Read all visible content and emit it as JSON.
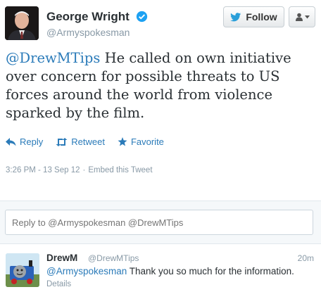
{
  "main_tweet": {
    "author_name": "George Wright",
    "author_handle": "@Armyspokesman",
    "mention": "@DrewMTips",
    "text": " He called on own initiative over concern for possible threats to US forces around the world from violence sparked by the film.",
    "follow_label": "Follow",
    "actions": {
      "reply": "Reply",
      "retweet": "Retweet",
      "favorite": "Favorite"
    },
    "timestamp": "3:26 PM - 13 Sep 12",
    "embed_label": "Embed this Tweet"
  },
  "reply_box": {
    "placeholder": "Reply to @Armyspokesman @DrewMTips"
  },
  "reply_tweet": {
    "author_name": "DrewM",
    "author_handle": "@DrewMTips",
    "time": "20m",
    "mention": "@Armyspokesman",
    "text": " Thank you so much for the information.",
    "details_label": "Details"
  },
  "colors": {
    "link": "#2b7bb9",
    "muted": "#8899a6",
    "verified": "#1da1f2"
  }
}
